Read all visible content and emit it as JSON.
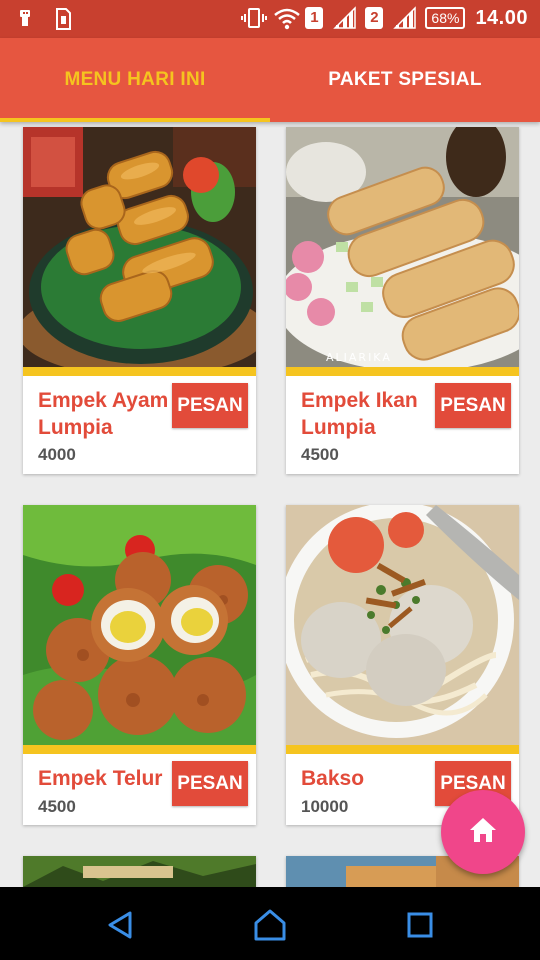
{
  "status_bar": {
    "sim1": "1",
    "sim2": "2",
    "battery": "68%",
    "time": "14.00",
    "icons": [
      "usb-icon",
      "sim-card-icon",
      "vibrate-icon",
      "wifi-icon",
      "signal-icon",
      "battery-icon"
    ]
  },
  "tabs": [
    {
      "label": "MENU HARI INI",
      "active": true
    },
    {
      "label": "PAKET SPESIAL",
      "active": false
    }
  ],
  "menu": [
    {
      "name": "Empek Ayam Lumpia",
      "price": "4000",
      "button": "PESAN",
      "image": "spring-rolls"
    },
    {
      "name": "Empek Ikan Lumpia",
      "price": "4500",
      "button": "PESAN",
      "image": "fried-fish-cakes"
    },
    {
      "name": "Empek Telur",
      "price": "4500",
      "button": "PESAN",
      "image": "quail-egg-fritters"
    },
    {
      "name": "Bakso",
      "price": "10000",
      "button": "PESAN",
      "image": "meatball-soup"
    }
  ],
  "colors": {
    "status_bar": "#c8402f",
    "tab_bar": "#e65640",
    "tab_active": "#f5c41f",
    "accent_red": "#e24b3a",
    "fab": "#f0468a"
  },
  "fab": {
    "icon": "home-icon"
  },
  "nav_bar": {
    "icons": [
      "back-icon",
      "home-nav-icon",
      "recents-icon"
    ]
  }
}
